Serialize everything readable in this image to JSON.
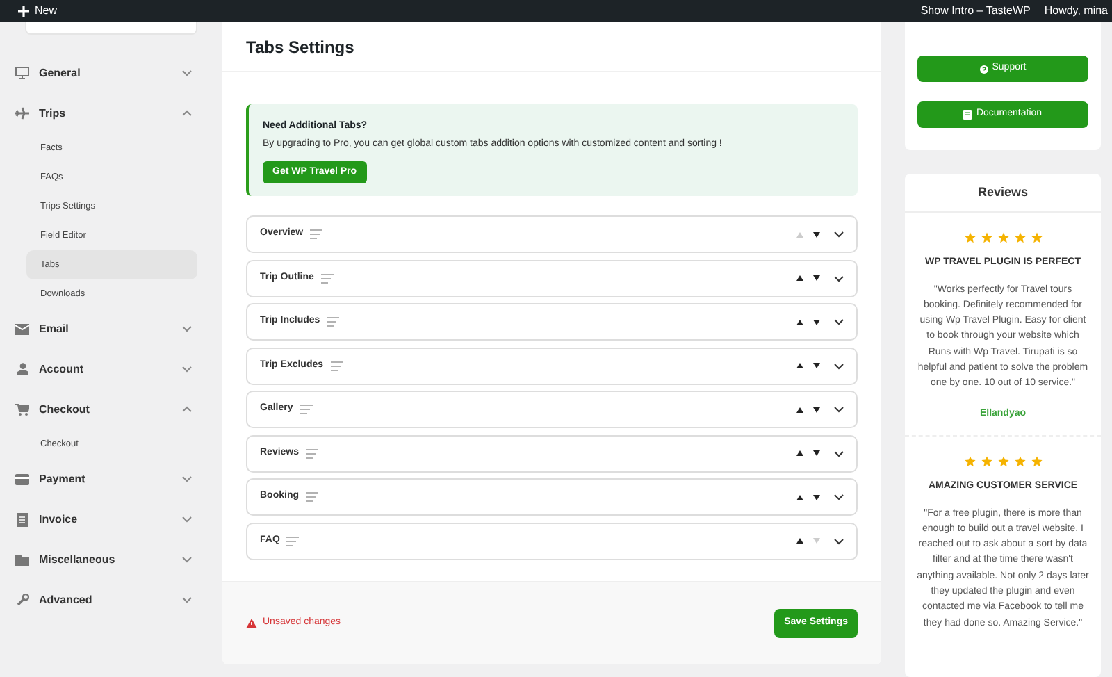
{
  "admin_bar": {
    "new_label": "New",
    "show_intro": "Show Intro – TasteWP",
    "howdy": "Howdy, mina"
  },
  "sidebar": {
    "groups": [
      {
        "label": "General",
        "expanded": false
      },
      {
        "label": "Trips",
        "expanded": true,
        "children": [
          {
            "label": "Facts",
            "selected": false
          },
          {
            "label": "FAQs",
            "selected": false
          },
          {
            "label": "Trips Settings",
            "selected": false
          },
          {
            "label": "Field Editor",
            "selected": false
          },
          {
            "label": "Tabs",
            "selected": true
          },
          {
            "label": "Downloads",
            "selected": false
          }
        ]
      },
      {
        "label": "Email",
        "expanded": false
      },
      {
        "label": "Account",
        "expanded": false
      },
      {
        "label": "Checkout",
        "expanded": true,
        "children": [
          {
            "label": "Checkout",
            "selected": false
          }
        ]
      },
      {
        "label": "Payment",
        "expanded": false
      },
      {
        "label": "Invoice",
        "expanded": false
      },
      {
        "label": "Miscellaneous",
        "expanded": false
      },
      {
        "label": "Advanced",
        "expanded": false
      }
    ]
  },
  "main": {
    "title": "Tabs Settings",
    "notice": {
      "title": "Need Additional Tabs?",
      "text": "By upgrading to Pro, you can get global custom tabs addition options with customized content and sorting !",
      "button": "Get WP Travel Pro"
    },
    "tabs": [
      {
        "label": "Overview",
        "up_disabled": true,
        "down_disabled": false
      },
      {
        "label": "Trip Outline",
        "up_disabled": false,
        "down_disabled": false
      },
      {
        "label": "Trip Includes",
        "up_disabled": false,
        "down_disabled": false
      },
      {
        "label": "Trip Excludes",
        "up_disabled": false,
        "down_disabled": false
      },
      {
        "label": "Gallery",
        "up_disabled": false,
        "down_disabled": false
      },
      {
        "label": "Reviews",
        "up_disabled": false,
        "down_disabled": false
      },
      {
        "label": "Booking",
        "up_disabled": false,
        "down_disabled": false
      },
      {
        "label": "FAQ",
        "up_disabled": false,
        "down_disabled": true
      }
    ],
    "footer": {
      "warning": "Unsaved changes",
      "save_button": "Save Settings"
    }
  },
  "side_panel": {
    "buttons": [
      "Support",
      "Documentation"
    ],
    "reviews": {
      "title": "Reviews",
      "items": [
        {
          "stars": 5,
          "heading": "WP TRAVEL PLUGIN IS PERFECT",
          "text": "\"Works perfectly for Travel tours booking. Definitely recommended for using Wp Travel Plugin. Easy for client to book through your website which Runs with Wp Travel. Tirupati is so helpful and patient to solve the problem one by one. 10 out of 10 service.\"",
          "author": "Ellandyao"
        },
        {
          "stars": 5,
          "heading": "AMAZING CUSTOMER SERVICE",
          "text": "\"For a free plugin, there is more than enough to build out a travel website. I reached out to ask about a sort by data filter and at the time there wasn't anything available. Not only 2 days later they updated the plugin and even contacted me via Facebook to tell me they had done so. Amazing Service.\""
        }
      ]
    }
  }
}
